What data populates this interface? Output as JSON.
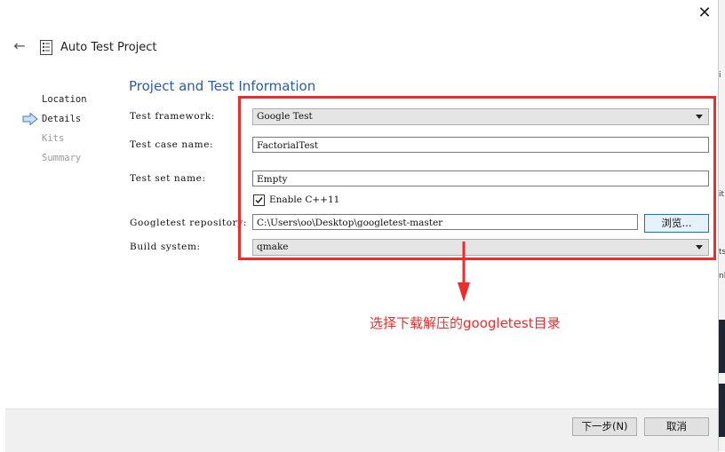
{
  "window": {
    "title": "Auto Test Project",
    "close_glyph": "✕",
    "back_glyph": "←"
  },
  "steps": [
    {
      "label": "Location",
      "state": "done"
    },
    {
      "label": "Details",
      "state": "current"
    },
    {
      "label": "Kits",
      "state": "pending"
    },
    {
      "label": "Summary",
      "state": "pending"
    }
  ],
  "page": {
    "title": "Project and Test Information"
  },
  "form": {
    "framework_label": "Test framework:",
    "framework_value": "Google Test",
    "case_label": "Test case name:",
    "case_value": "FactorialTest",
    "set_label": "Test set name:",
    "set_value": "Empty",
    "cpp11_label": "Enable C++11",
    "cpp11_checked": true,
    "repo_label": "Googletest repository:",
    "repo_value": "C:\\Users\\oo\\Desktop\\googletest-master",
    "browse_label": "浏览...",
    "build_label": "Build system:",
    "build_value": "qmake"
  },
  "footer": {
    "next_label": "下一步(N)",
    "cancel_label": "取消"
  },
  "annotation": {
    "text": "选择下载解压的googletest目录",
    "color": "#ee2c2c"
  },
  "background_fragments": [
    "i",
    "it",
    "ts",
    "nl"
  ],
  "icons": {
    "back": "back-arrow-icon",
    "wizard": "wizard-doc-icon",
    "current_step": "current-step-arrow-icon",
    "combo": "chevron-down-icon",
    "checkbox": "checkmark-icon",
    "close": "close-icon"
  }
}
